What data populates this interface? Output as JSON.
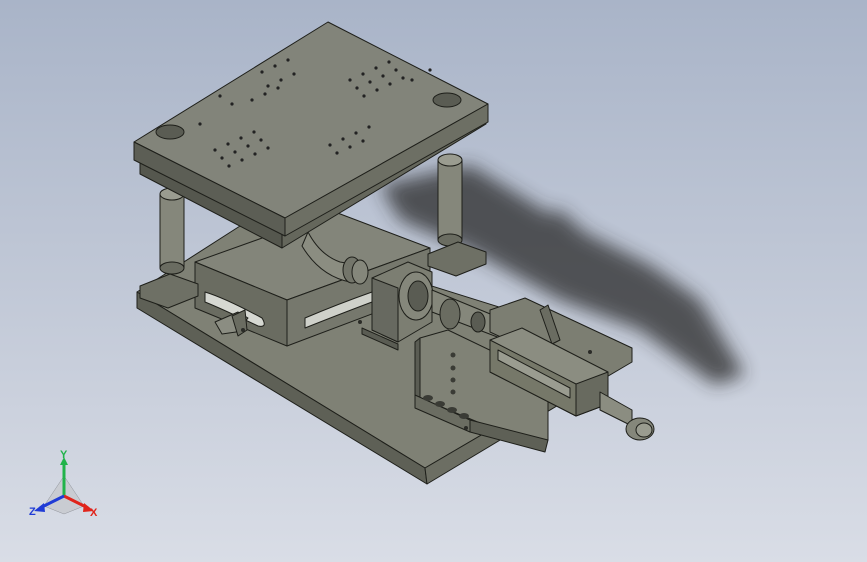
{
  "viewport": {
    "background_top": "#a9b4c8",
    "background_bottom": "#d9dde6",
    "model_color": "#7d7f73",
    "model_edge_color": "#1e1f1a"
  },
  "triad": {
    "x_label": "X",
    "y_label": "Y",
    "z_label": "Z",
    "x_color": "#e0241b",
    "y_color": "#21b34a",
    "z_color": "#1f3bd6"
  }
}
